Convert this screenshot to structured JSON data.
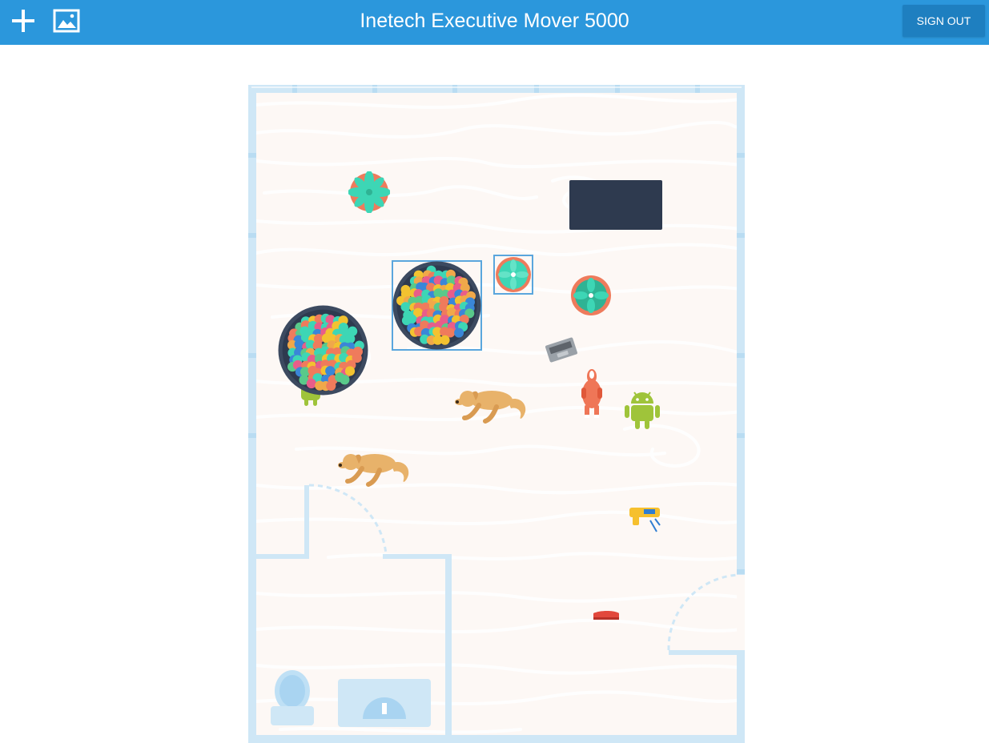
{
  "app": {
    "title": "Inetech Executive Mover 5000",
    "sign_out_label": "SIGN OUT",
    "add_icon": "plus-icon",
    "background_icon": "image-icon"
  },
  "colors": {
    "app_bar": "#2b97dc",
    "sign_out_bg": "#1e7fc0",
    "floor": "#fdf8f5",
    "walls": "#cfe7f6",
    "selection": "#5aa6dd",
    "desk": "#2e3a4f",
    "pot": "#ee7b5c",
    "succulent": "#3dd6b5"
  },
  "floor_plan": {
    "items": [
      {
        "type": "plant",
        "selected": false
      },
      {
        "type": "desk",
        "selected": false
      },
      {
        "type": "ball-pit",
        "selected": true
      },
      {
        "type": "plant",
        "selected": true
      },
      {
        "type": "plant",
        "selected": false
      },
      {
        "type": "ball-pit",
        "selected": false
      },
      {
        "type": "android",
        "selected": false
      },
      {
        "type": "laptop",
        "selected": false
      },
      {
        "type": "dog",
        "selected": false
      },
      {
        "type": "inflatable-dinosaur",
        "selected": false
      },
      {
        "type": "android",
        "selected": false
      },
      {
        "type": "dog",
        "selected": false
      },
      {
        "type": "nerf-gun",
        "selected": false
      },
      {
        "type": "stapler",
        "selected": false
      },
      {
        "type": "toilet",
        "selected": false
      },
      {
        "type": "sink",
        "selected": false
      }
    ]
  }
}
